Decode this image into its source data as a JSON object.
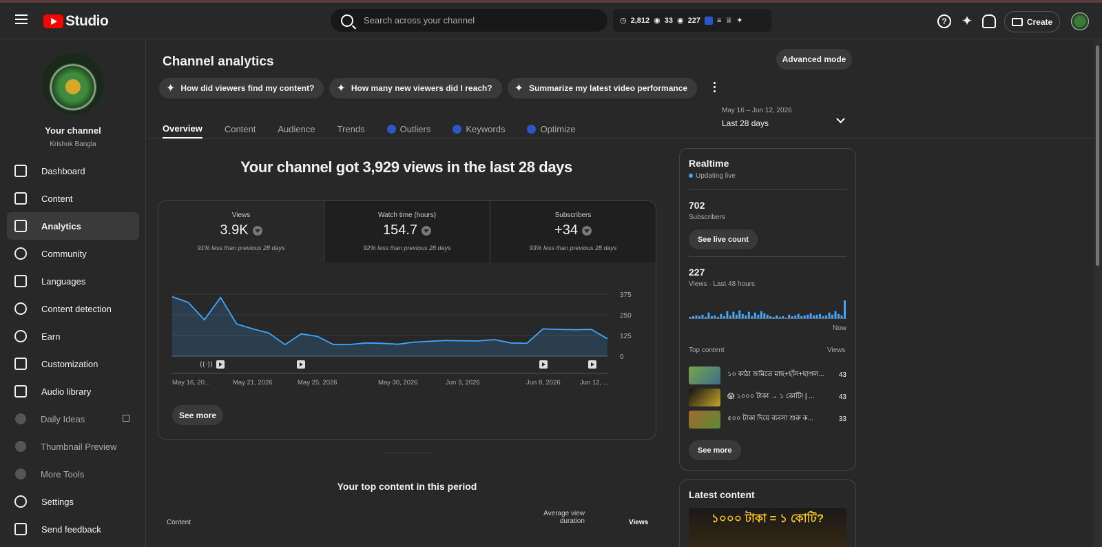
{
  "header": {
    "logo_text": "Studio",
    "search_placeholder": "Search across your channel",
    "ext_stats": {
      "a": "2,812",
      "b": "33",
      "c": "227"
    },
    "create_label": "Create"
  },
  "sidebar": {
    "your_channel": "Your channel",
    "channel_name": "Krishok Bangla",
    "items": [
      {
        "label": "Dashboard",
        "icon": "dashboard-icon"
      },
      {
        "label": "Content",
        "icon": "content-icon"
      },
      {
        "label": "Analytics",
        "icon": "analytics-icon",
        "active": true
      },
      {
        "label": "Community",
        "icon": "community-icon"
      },
      {
        "label": "Languages",
        "icon": "languages-icon"
      },
      {
        "label": "Content detection",
        "icon": "copyright-icon"
      },
      {
        "label": "Earn",
        "icon": "earn-icon"
      },
      {
        "label": "Customization",
        "icon": "customization-icon"
      },
      {
        "label": "Audio library",
        "icon": "audio-library-icon"
      },
      {
        "label": "Daily Ideas",
        "icon": "vidiq-icon"
      },
      {
        "label": "Thumbnail Preview",
        "icon": "vidiq-icon"
      },
      {
        "label": "More Tools",
        "icon": "vidiq-icon"
      },
      {
        "label": "Settings",
        "icon": "gear-icon"
      },
      {
        "label": "Send feedback",
        "icon": "feedback-icon"
      }
    ]
  },
  "page": {
    "title": "Channel analytics",
    "advanced_mode": "Advanced mode",
    "chips": [
      "How did viewers find my content?",
      "How many new viewers did I reach?",
      "Summarize my latest video performance"
    ],
    "tabs": [
      "Overview",
      "Content",
      "Audience",
      "Trends",
      "Outliers",
      "Keywords",
      "Optimize"
    ],
    "date_range": "May 16 – Jun 12, 2026",
    "date_label": "Last 28 days",
    "headline": "Your channel got 3,929 views in the last 28 days"
  },
  "metrics": [
    {
      "label": "Views",
      "value": "3.9K",
      "compare": "91% less than previous 28 days"
    },
    {
      "label": "Watch time (hours)",
      "value": "154.7",
      "compare": "92% less than previous 28 days"
    },
    {
      "label": "Subscribers",
      "value": "+34",
      "compare": "93% less than previous 28 days"
    }
  ],
  "chart_data": {
    "type": "area",
    "x_tick_labels": [
      "May 16, 20...",
      "May 21, 2026",
      "May 25, 2026",
      "May 30, 2026",
      "Jun 3, 2026",
      "Jun 8, 2026",
      "Jun 12, ..."
    ],
    "y_ticks": [
      375,
      250,
      125,
      0
    ],
    "ylim": [
      0,
      375
    ],
    "values": [
      360,
      325,
      220,
      355,
      195,
      165,
      140,
      70,
      135,
      120,
      70,
      70,
      80,
      78,
      72,
      85,
      90,
      95,
      93,
      92,
      100,
      80,
      78,
      165,
      162,
      160,
      162,
      105
    ],
    "color": "#3ea6ff"
  },
  "chart_see_more": "See more",
  "top_content": {
    "title": "Your top content in this period",
    "col_content": "Content",
    "col_avd": "Average view duration",
    "col_views": "Views"
  },
  "realtime": {
    "title": "Realtime",
    "status": "Updating live",
    "subs": "702",
    "subs_label": "Subscribers",
    "live_count_btn": "See live count",
    "views": "227",
    "views_label": "Views · Last 48 hours",
    "now_label": "Now",
    "bars": [
      2,
      3,
      4,
      3,
      5,
      2,
      8,
      3,
      4,
      2,
      6,
      3,
      10,
      4,
      9,
      5,
      11,
      6,
      4,
      9,
      3,
      8,
      5,
      10,
      7,
      5,
      3,
      2,
      4,
      2,
      3,
      1,
      5,
      3,
      4,
      6,
      3,
      4,
      5,
      7,
      4,
      5,
      6,
      3,
      4,
      8,
      5,
      10,
      6,
      4,
      25
    ],
    "top_content_label": "Top content",
    "views_col": "Views",
    "items": [
      {
        "title": "১০ কাঠা জমিতে মাছ+হাঁস+ছাগল...",
        "views": "43"
      },
      {
        "title": "😱 ১০০০ টাকা → ১ কোটি! | ...",
        "views": "43"
      },
      {
        "title": "৫০০ টাকা দিয়ে ব্যবসা শুরু ক...",
        "views": "33"
      }
    ],
    "see_more": "See more"
  },
  "latest_content": {
    "title": "Latest content",
    "thumb_text": "১০০০ টাকা = ১ কোটি?"
  }
}
